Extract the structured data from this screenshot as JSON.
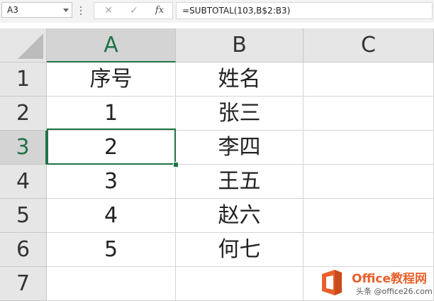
{
  "formula_bar": {
    "name_box": "A3",
    "cancel_glyph": "✕",
    "enter_glyph": "✓",
    "insert_function_glyph": "fx",
    "formula": "=SUBTOTAL(103,B$2:B3)"
  },
  "grid": {
    "columns": [
      "A",
      "B",
      "C"
    ],
    "rows": [
      {
        "num": "1",
        "a": "序号",
        "b": "姓名",
        "c": ""
      },
      {
        "num": "2",
        "a": "1",
        "b": "张三",
        "c": ""
      },
      {
        "num": "3",
        "a": "2",
        "b": "李四",
        "c": ""
      },
      {
        "num": "4",
        "a": "3",
        "b": "王五",
        "c": ""
      },
      {
        "num": "5",
        "a": "4",
        "b": "赵六",
        "c": ""
      },
      {
        "num": "6",
        "a": "5",
        "b": "何七",
        "c": ""
      },
      {
        "num": "7",
        "a": "",
        "b": "",
        "c": ""
      }
    ],
    "active_cell": "A3"
  },
  "watermark": {
    "brand": "Office教程网",
    "sub": "头条 @office26.com"
  },
  "colors": {
    "accent": "#217346",
    "header_bg": "#e6e6e6",
    "watermark_orange": "#e8612c"
  },
  "icons": {
    "name_box_dropdown": "chevron-down-icon",
    "cancel": "close-icon",
    "enter": "check-icon",
    "insert_function": "function-icon",
    "select_all": "select-all-icon",
    "logo": "office-logo-icon"
  }
}
